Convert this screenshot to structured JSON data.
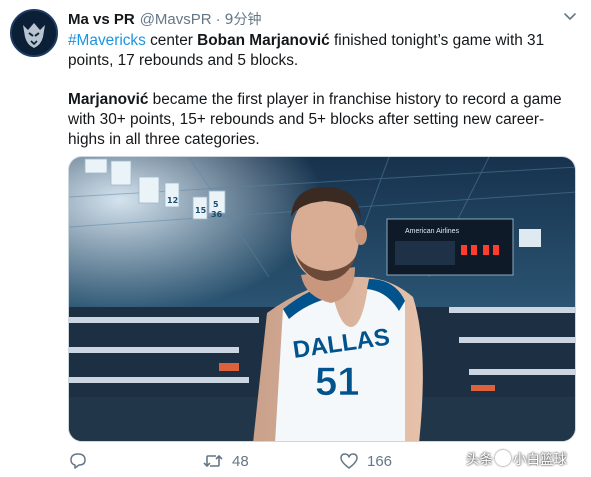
{
  "tweet": {
    "author_name": "Ma vs PR",
    "handle": "@MavsPR",
    "separator": "·",
    "time": "9分钟",
    "line1_hashtag": "#Mavericks",
    "line1_text_a": " center ",
    "line1_bold": "Boban Marjanović",
    "line1_text_b": " finished tonight’s game with 31 points, 17 rebounds and 5 blocks.",
    "para2_bold": "Marjanović",
    "para2_text": " became the first player in franchise history to record a game with 30+ points, 15+ rebounds and 5+ blocks after setting new career-highs in all three categories."
  },
  "photo": {
    "jersey_team": "DALLAS",
    "jersey_number": "51",
    "scoreboard_brand": "American Airlines",
    "banner_numbers": [
      "12",
      "15",
      "5",
      "36"
    ]
  },
  "actions": {
    "reply_count": "",
    "retweet_count": "48",
    "like_count": "166"
  },
  "watermark": {
    "prefix": "头条",
    "account": "小白篮球"
  },
  "colors": {
    "link": "#1b95e0",
    "secondary_text": "#657786",
    "jersey_blue": "#00538c"
  }
}
